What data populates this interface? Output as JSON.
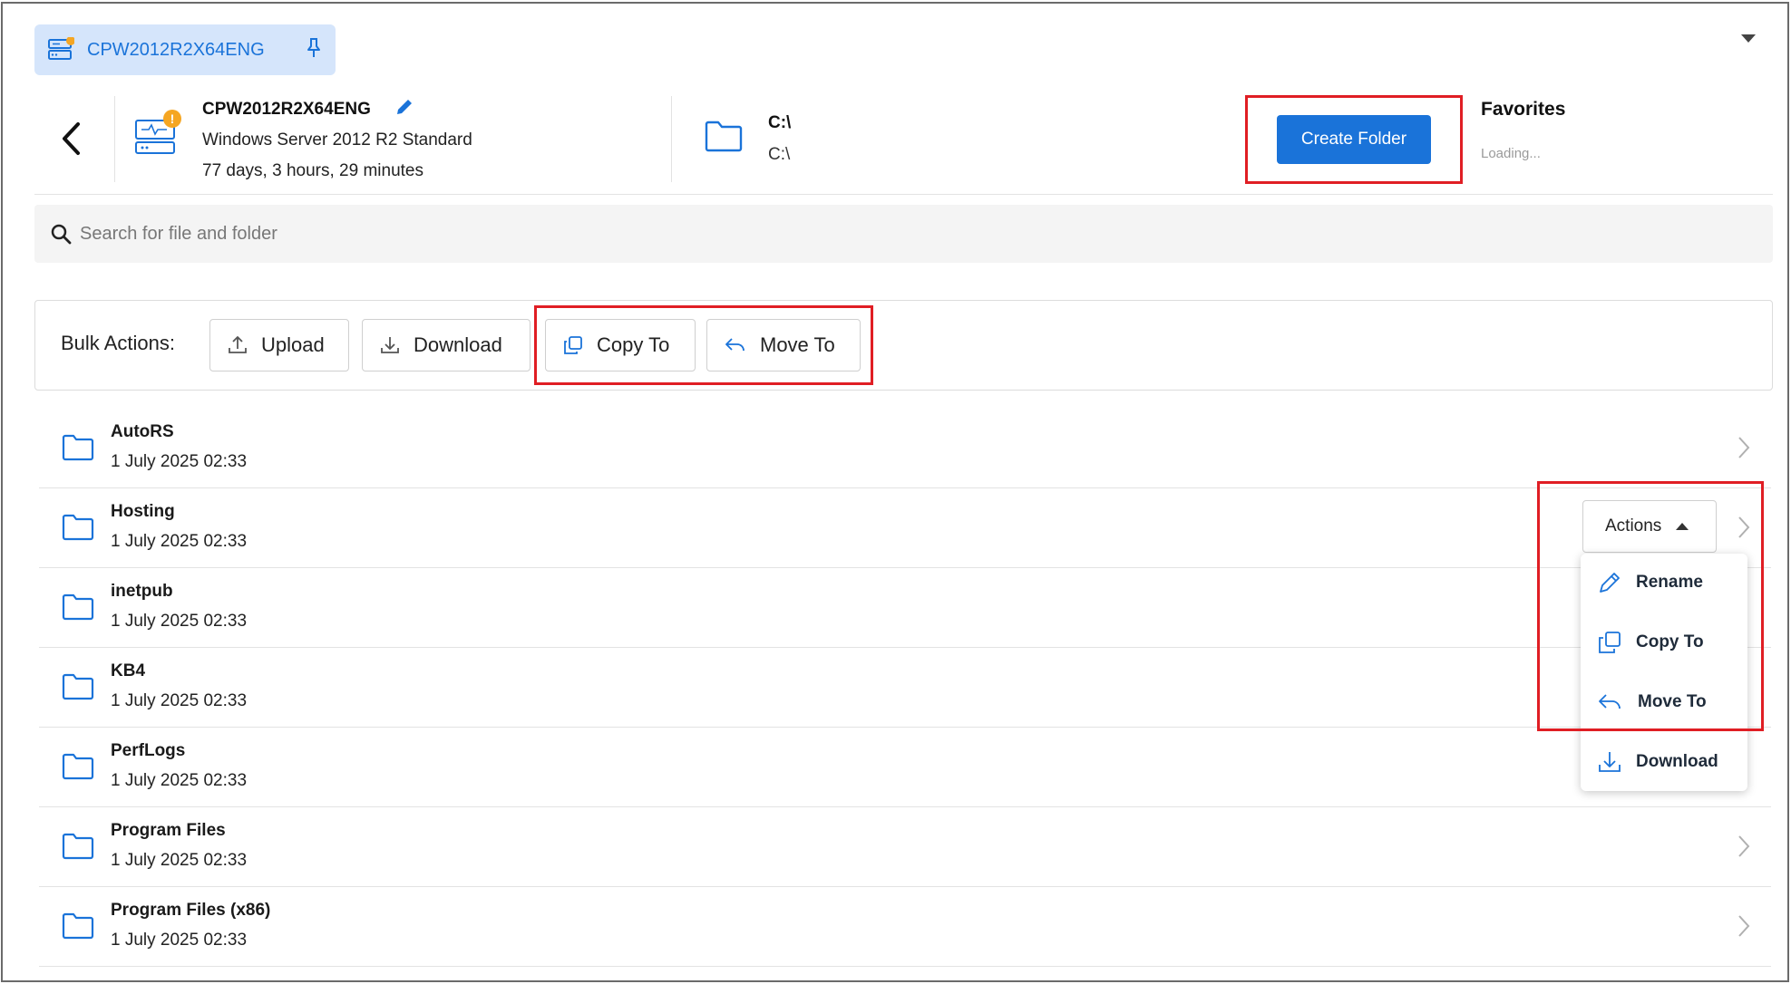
{
  "tab": {
    "label": "CPW2012R2X64ENG"
  },
  "server": {
    "name": "CPW2012R2X64ENG",
    "os": "Windows Server 2012 R2 Standard",
    "uptime": "77 days, 3 hours, 29 minutes",
    "badge": "!"
  },
  "path": {
    "title": "C:\\",
    "subtitle": "C:\\"
  },
  "toolbar": {
    "create_folder_label": "Create Folder"
  },
  "favorites": {
    "title": "Favorites",
    "status": "Loading..."
  },
  "search": {
    "placeholder": "Search for file and folder",
    "value": ""
  },
  "bulk_actions": {
    "label": "Bulk Actions:",
    "upload": "Upload",
    "download": "Download",
    "copy_to": "Copy To",
    "move_to": "Move To"
  },
  "folders": [
    {
      "name": "AutoRS",
      "date": "1 July 2025 02:33"
    },
    {
      "name": "Hosting",
      "date": "1 July 2025 02:33"
    },
    {
      "name": "inetpub",
      "date": "1 July 2025 02:33"
    },
    {
      "name": "KB4",
      "date": "1 July 2025 02:33"
    },
    {
      "name": "PerfLogs",
      "date": "1 July 2025 02:33"
    },
    {
      "name": "Program Files",
      "date": "1 July 2025 02:33"
    },
    {
      "name": "Program Files (x86)",
      "date": "1 July 2025 02:33"
    }
  ],
  "row_actions": {
    "button_label": "Actions",
    "menu": {
      "rename": "Rename",
      "copy_to": "Copy To",
      "move_to": "Move To",
      "download": "Download"
    }
  },
  "colors": {
    "accent": "#1a73d9",
    "tab_bg": "#d5e5fb",
    "highlight": "#e01e24",
    "badge": "#f5a623"
  }
}
